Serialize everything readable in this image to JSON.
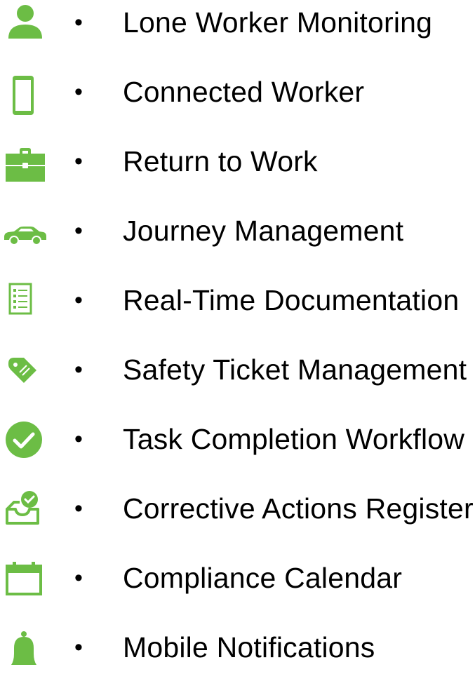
{
  "theme": {
    "icon_color": "#6cbd45",
    "text_color": "#000000"
  },
  "bullet": "•",
  "features": [
    {
      "icon": "person-icon",
      "label": "Lone Worker Monitoring"
    },
    {
      "icon": "smartphone-icon",
      "label": "Connected Worker"
    },
    {
      "icon": "briefcase-icon",
      "label": "Return to Work"
    },
    {
      "icon": "car-icon",
      "label": "Journey Management"
    },
    {
      "icon": "checklist-document-icon",
      "label": "Real-Time Documentation"
    },
    {
      "icon": "tag-icon",
      "label": "Safety Ticket Management"
    },
    {
      "icon": "check-circle-icon",
      "label": "Task Completion Workflow"
    },
    {
      "icon": "inbox-check-icon",
      "label": "Corrective Actions Register"
    },
    {
      "icon": "calendar-icon",
      "label": "Compliance Calendar"
    },
    {
      "icon": "bell-icon",
      "label": "Mobile Notifications"
    }
  ]
}
